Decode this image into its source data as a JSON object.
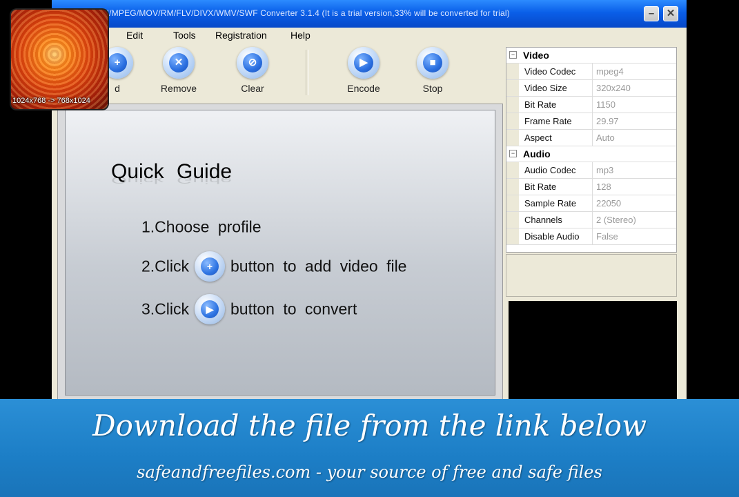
{
  "window": {
    "title": "...and AVI/MPEG/MOV/RM/FLV/DIVX/WMV/SWF Converter 3.1.4 (It is a trial version,33% will be converted for trial)",
    "minimize_glyph": "–",
    "close_glyph": "✕"
  },
  "menu": {
    "items": [
      "Edit",
      "Tools",
      "Registration",
      "Help"
    ]
  },
  "toolbar": {
    "add": {
      "label": "d",
      "glyph": "+"
    },
    "remove": {
      "label": "Remove",
      "glyph": "✕"
    },
    "clear": {
      "label": "Clear",
      "glyph": "⊘"
    },
    "encode": {
      "label": "Encode",
      "glyph": "▶"
    },
    "stop": {
      "label": "Stop",
      "glyph": "■"
    }
  },
  "guide": {
    "title": "Quick Guide",
    "step1": "1.Choose profile",
    "step2_pre": "2.Click",
    "step2_post": "button to add video file",
    "step3_pre": "3.Click",
    "step3_post": "button to convert",
    "add_glyph": "+",
    "play_glyph": "▶"
  },
  "properties": {
    "video": {
      "header": "Video",
      "toggle": "−",
      "rows": [
        {
          "k": "Video Codec",
          "v": "mpeg4"
        },
        {
          "k": "Video Size",
          "v": "320x240"
        },
        {
          "k": "Bit Rate",
          "v": "1150"
        },
        {
          "k": "Frame Rate",
          "v": "29.97"
        },
        {
          "k": "Aspect",
          "v": "Auto"
        }
      ]
    },
    "audio": {
      "header": "Audio",
      "toggle": "−",
      "rows": [
        {
          "k": "Audio Codec",
          "v": "mp3"
        },
        {
          "k": "Bit Rate",
          "v": "128"
        },
        {
          "k": "Sample Rate",
          "v": "22050"
        },
        {
          "k": "Channels",
          "v": "2 (Stereo)"
        },
        {
          "k": "Disable Audio",
          "v": "False"
        }
      ]
    }
  },
  "thumbnail": {
    "label": "1024x768 -> 768x1024"
  },
  "banner": {
    "line1": "Download the file from the link below",
    "line2": "safeandfreefiles.com - your source of free and safe files"
  },
  "colors": {
    "title_blue": "#0a5fe8",
    "banner_blue": "#1c7ec6",
    "window_face": "#ece9d8"
  }
}
